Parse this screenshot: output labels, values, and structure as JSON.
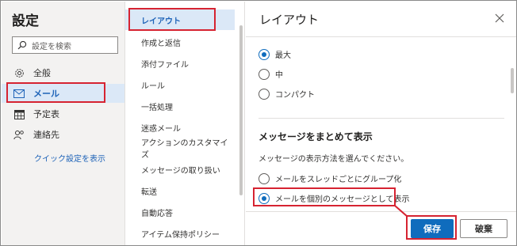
{
  "sidebar": {
    "title": "設定",
    "search_placeholder": "設定を検索",
    "items": [
      {
        "label": "全般",
        "icon": "gear-icon"
      },
      {
        "label": "メール",
        "icon": "mail-icon"
      },
      {
        "label": "予定表",
        "icon": "calendar-icon"
      },
      {
        "label": "連絡先",
        "icon": "people-icon"
      }
    ],
    "quick_settings_link": "クイック設定を表示"
  },
  "mail_menu": {
    "items": [
      {
        "label": "レイアウト"
      },
      {
        "label": "作成と返信"
      },
      {
        "label": "添付ファイル"
      },
      {
        "label": "ルール"
      },
      {
        "label": "一括処理"
      },
      {
        "label": "迷惑メール"
      },
      {
        "label": "アクションのカスタマイズ"
      },
      {
        "label": "メッセージの取り扱い"
      },
      {
        "label": "転送"
      },
      {
        "label": "自動応答"
      },
      {
        "label": "アイテム保持ポリシー"
      }
    ]
  },
  "pane": {
    "title": "レイアウト",
    "density_options": [
      {
        "label": "最大",
        "selected": true
      },
      {
        "label": "中",
        "selected": false
      },
      {
        "label": "コンパクト",
        "selected": false
      }
    ],
    "section_title": "メッセージをまとめて表示",
    "section_description": "メッセージの表示方法を選んでください。",
    "group_options": [
      {
        "label": "メールをスレッドごとにグループ化",
        "selected": false
      },
      {
        "label": "メールを個別のメッセージとして表示",
        "selected": true
      }
    ],
    "save_label": "保存",
    "discard_label": "破棄"
  },
  "colors": {
    "accent": "#0f6cbd",
    "highlight": "#d62331",
    "selected_bg": "#dbe8f7"
  }
}
